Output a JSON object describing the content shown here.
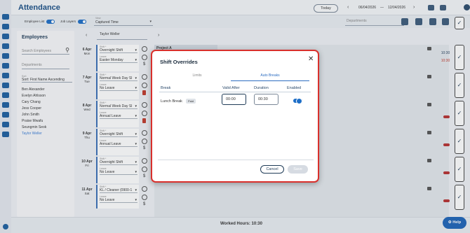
{
  "header": {
    "title": "Attendance",
    "today_label": "Today",
    "date_from": "06/04/2026",
    "date_to": "12/04/2026",
    "prev_icon": "chevron-left-icon",
    "next_icon": "chevron-right-icon"
  },
  "toolbar": {
    "employee_list_label": "Employee List",
    "job_layers_label": "Job Layers",
    "view_label": "View",
    "view_value": "Captured Time",
    "departments_placeholder": "Departments"
  },
  "employees": {
    "title": "Employees",
    "search_placeholder": "Search Employees",
    "departments_placeholder": "Departments",
    "sort_label": "Sort",
    "sort_value": "Sort: First Name Ascending",
    "list": [
      "Ben Alexander",
      "Evelyn Ahlsson",
      "Cary Chang",
      "Jess Cooper",
      "John Smith",
      "Praise Mwafu",
      "Seungmin Seok",
      "Taylor Weller"
    ],
    "selected": "Taylor Weller"
  },
  "schedule": {
    "employee_value": "Taylor Weller",
    "project_tag": "Project A",
    "shift_label": "Shift *",
    "leave_label": "Leave",
    "days": [
      {
        "date": "6 Apr",
        "weekday": "Mon",
        "shift": "Overnight Shift",
        "leave": "Easter Monday"
      },
      {
        "date": "7 Apr",
        "weekday": "Tue",
        "shift": "Normal Week Day Sl",
        "leave": "No Leave"
      },
      {
        "date": "8 Apr",
        "weekday": "Wed",
        "shift": "Normal Week Day Sl",
        "leave": "Annual Leave"
      },
      {
        "date": "9 Apr",
        "weekday": "Thu",
        "shift": "Overnight Shift",
        "leave": "Annual Leave"
      },
      {
        "date": "10 Apr",
        "weekday": "Fri",
        "shift": "Overnight Shift",
        "leave": "No Leave"
      },
      {
        "date": "11 Apr",
        "weekday": "Sat",
        "shift": "KL / Cleaner (0900-1",
        "leave": "No Leave"
      }
    ],
    "time_black": "10:30",
    "time_red": "10:30",
    "worked_hours": "Worked Hours: 10:30"
  },
  "modal": {
    "title": "Shift Overrides",
    "tabs": [
      "Limits",
      "Auto Breaks"
    ],
    "active_tab": "Auto Breaks",
    "columns": {
      "break": "Break",
      "valid_after": "Valid After",
      "duration": "Duration",
      "enabled": "Enabled"
    },
    "row": {
      "break_name": "Lunch Break",
      "badge": "Paid",
      "valid_after": "00:00",
      "duration": "00:30",
      "enabled": true
    },
    "cancel_label": "Cancel",
    "save_label": "Save"
  },
  "help_label": "Help",
  "colors": {
    "accent": "#1d63b8",
    "brand": "#1a4f86",
    "danger": "#d9302c"
  }
}
